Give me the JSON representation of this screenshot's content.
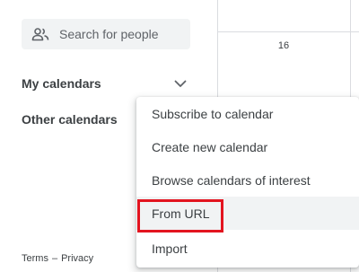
{
  "sidebar": {
    "search": {
      "placeholder": "Search for people",
      "icon": "people-icon"
    },
    "my_calendars": {
      "label": "My calendars",
      "icon": "chevron-down-icon"
    },
    "other_calendars": {
      "label": "Other calendars"
    },
    "footer": {
      "terms": "Terms",
      "separator": "–",
      "privacy": "Privacy"
    }
  },
  "calendar": {
    "day_number": "16"
  },
  "menu": {
    "items": [
      {
        "label": "Subscribe to calendar"
      },
      {
        "label": "Create new calendar"
      },
      {
        "label": "Browse calendars of interest"
      },
      {
        "label": "From URL",
        "highlighted": true
      },
      {
        "label": "Import"
      }
    ]
  },
  "colors": {
    "highlight_border": "#e3141f",
    "hover_bg": "#f1f3f4",
    "text": "#3c4043",
    "muted": "#5f6368",
    "grid_line": "#dadce0"
  }
}
